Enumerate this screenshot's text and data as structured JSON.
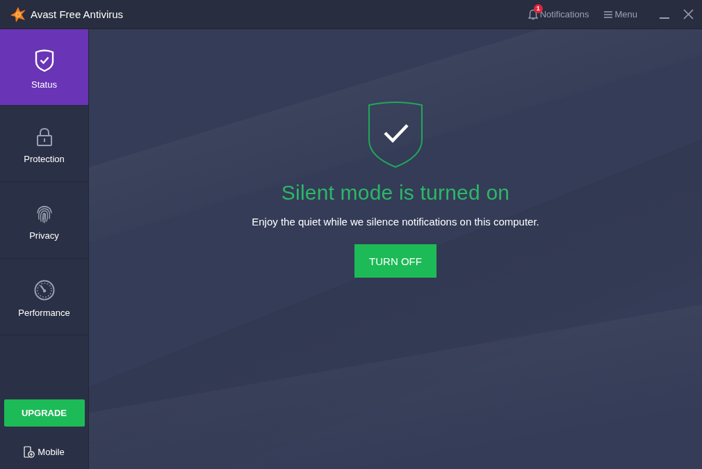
{
  "window": {
    "title": "Avast Free Antivirus",
    "notifications": {
      "label": "Notifications",
      "badge": "1"
    },
    "menu_label": "Menu"
  },
  "sidebar": {
    "items": [
      {
        "label": "Status",
        "selected": true
      },
      {
        "label": "Protection",
        "selected": false
      },
      {
        "label": "Privacy",
        "selected": false
      },
      {
        "label": "Performance",
        "selected": false
      }
    ],
    "upgrade_button": "UPGRADE",
    "mobile_link": "Mobile"
  },
  "main": {
    "title": "Silent mode is turned on",
    "message": "Enjoy the quiet while we silence notifications on this computer.",
    "button": "TURN OFF"
  }
}
